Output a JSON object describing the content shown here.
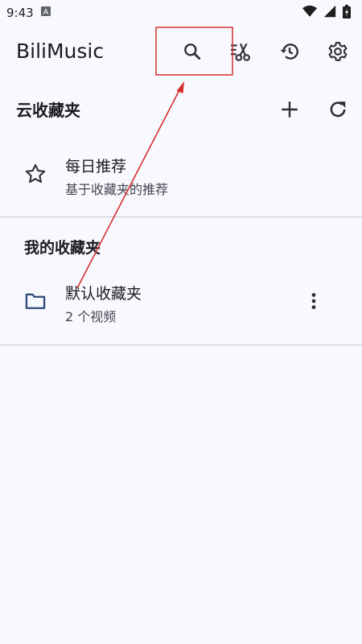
{
  "status_bar": {
    "time": "9:43",
    "notification_icon": "a-box-icon",
    "wifi_icon": "wifi-icon",
    "signal_icon": "signal-icon",
    "battery_icon": "battery-icon"
  },
  "app_bar": {
    "title": "BiliMusic",
    "actions": [
      "search-icon",
      "scissors-icon",
      "history-icon",
      "settings-icon"
    ]
  },
  "cloud_section": {
    "title": "云收藏夹",
    "actions": [
      "add-icon",
      "refresh-icon"
    ],
    "items": [
      {
        "title": "每日推荐",
        "subtitle": "基于收藏夹的推荐",
        "icon": "star-icon"
      }
    ]
  },
  "my_section": {
    "title": "我的收藏夹",
    "items": [
      {
        "title": "默认收藏夹",
        "subtitle": "2 个视频",
        "icon": "folder-icon",
        "trailing": "more-vert-icon"
      }
    ]
  },
  "colors": {
    "background": "#f8f9ff",
    "text": "#1b1b1f",
    "secondary_text": "#45464f",
    "icon": "#2f3033",
    "folder_icon": "#2e4a78",
    "annotation_red": "#d32f2f"
  }
}
